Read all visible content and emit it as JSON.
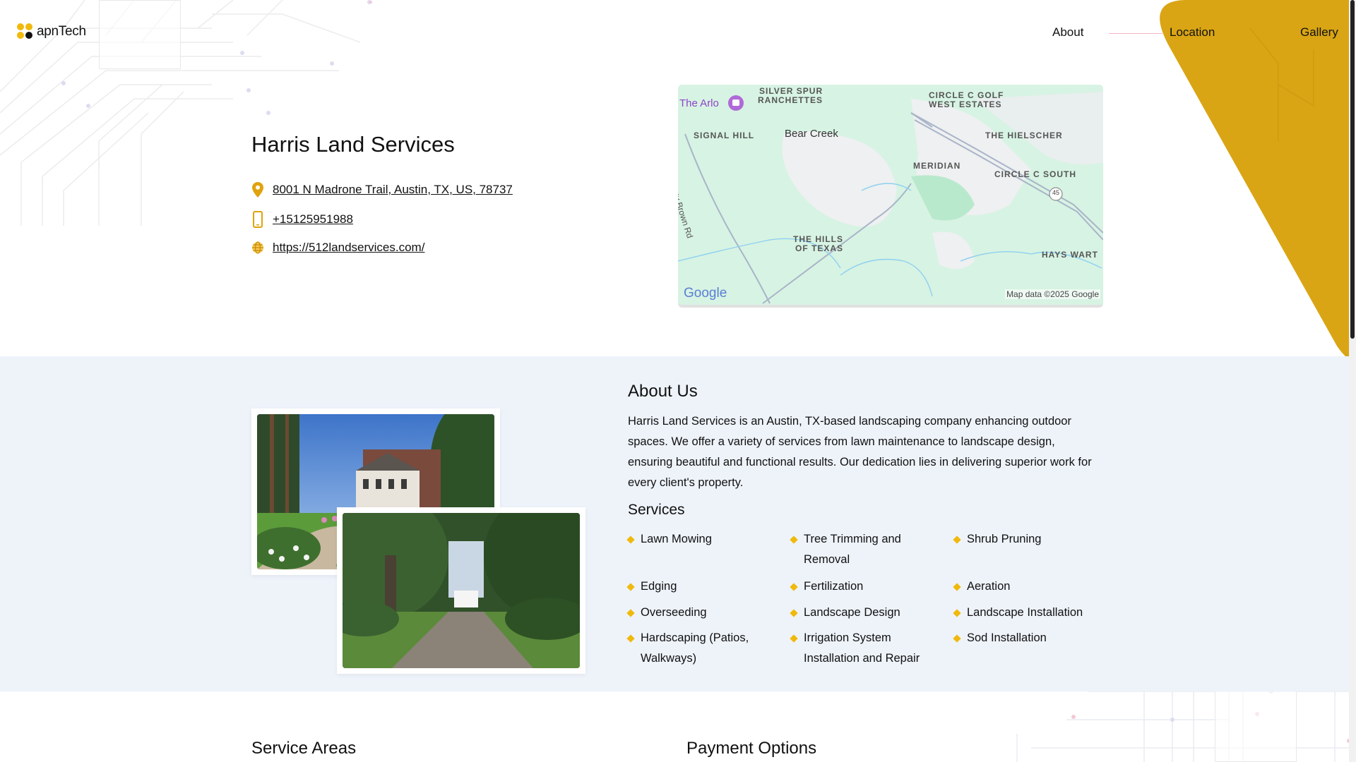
{
  "brand": {
    "logo_text": "apnTech"
  },
  "nav": {
    "about": "About",
    "location": "Location",
    "gallery": "Gallery"
  },
  "business": {
    "name": "Harris Land Services",
    "address": "8001 N Madrone Trail, Austin, TX, US, 78737",
    "phone": "+15125951988",
    "website": "https://512landservices.com/"
  },
  "map": {
    "labels": {
      "arlo": "The Arlo",
      "silver_spur_1": "SILVER SPUR",
      "silver_spur_2": "RANCHETTES",
      "golf_1": "CIRCLE C GOLF",
      "golf_2": "WEST ESTATES",
      "signal_hill": "SIGNAL HILL",
      "bear_creek": "Bear Creek",
      "hielscher": "THE HIELSCHER",
      "meridian": "MERIDIAN",
      "circle_c_south": "CIRCLE C SOUTH",
      "nutty_brown": "Nutty Brown Rd",
      "hills_1": "THE HILLS",
      "hills_2": "OF TEXAS",
      "hays_wart": "HAYS WART",
      "route": "45",
      "google": "Google",
      "attribution": "Map data ©2025 Google"
    }
  },
  "about": {
    "title": "About Us",
    "text": "Harris Land Services is an Austin, TX-based landscaping company enhancing outdoor spaces. We offer a variety of services from lawn maintenance to landscape design, ensuring beautiful and functional results. Our dedication lies in delivering superior work for every client's property."
  },
  "services": {
    "title": "Services",
    "items": [
      "Lawn Mowing",
      "Tree Trimming and Removal",
      "Shrub Pruning",
      "Edging",
      "Fertilization",
      "Aeration",
      "Overseeding",
      "Landscape Design",
      "Landscape Installation",
      "Hardscaping (Patios, Walkways)",
      "Irrigation System Installation and Repair",
      "Sod Installation"
    ]
  },
  "bottom": {
    "service_areas": "Service Areas",
    "payment_options": "Payment Options"
  },
  "colors": {
    "accent": "#f0b90b",
    "gold": "#d9a514",
    "band": "#eef3fa",
    "map_bg": "#d7f3e3"
  }
}
